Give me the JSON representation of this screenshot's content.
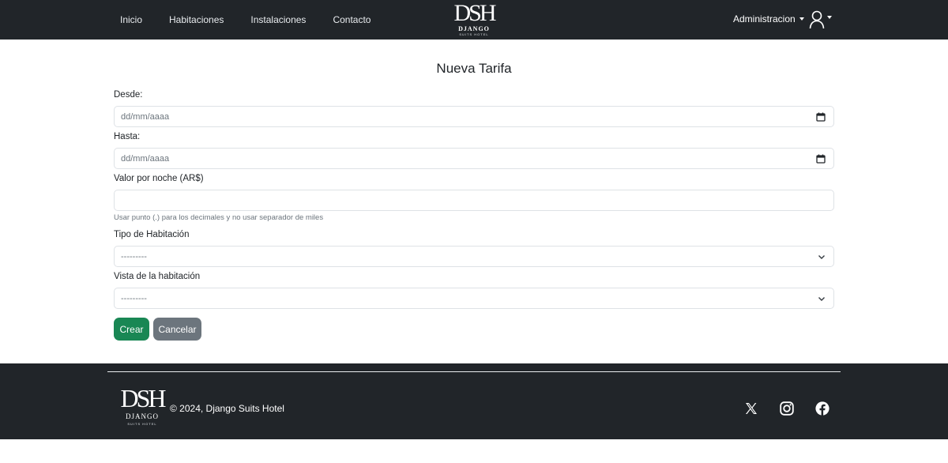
{
  "navbar": {
    "links": [
      "Inicio",
      "Habitaciones",
      "Instalaciones",
      "Contacto"
    ],
    "brand": {
      "monogram": "DSH",
      "name": "DJANGO",
      "tagline": "SUITS HOTEL"
    },
    "admin_label": "Administracion",
    "user_icon": "user-icon"
  },
  "form": {
    "title": "Nueva Tarifa",
    "desde_label": "Desde:",
    "desde_placeholder": "dd/mm/aaaa",
    "hasta_label": "Hasta:",
    "hasta_placeholder": "dd/mm/aaaa",
    "valor_label": "Valor por noche (AR$)",
    "valor_value": "",
    "valor_help": "Usar punto (.) para los decimales y no usar separador de miles",
    "tipo_label": "Tipo de Habitación",
    "tipo_selected": "---------",
    "vista_label": "Vista de la habitación",
    "vista_selected": "---------",
    "create_label": "Crear",
    "cancel_label": "Cancelar"
  },
  "footer": {
    "logo": {
      "monogram": "DSH",
      "name": "DJANGO",
      "tagline": "SUITS HOTEL"
    },
    "copyright": "© 2024, Django Suits Hotel",
    "social_icons": [
      "x-icon",
      "instagram-icon",
      "facebook-icon"
    ]
  },
  "colors": {
    "navbar_bg": "#212529",
    "create_button": "#198754",
    "cancel_button": "#6c757d"
  }
}
